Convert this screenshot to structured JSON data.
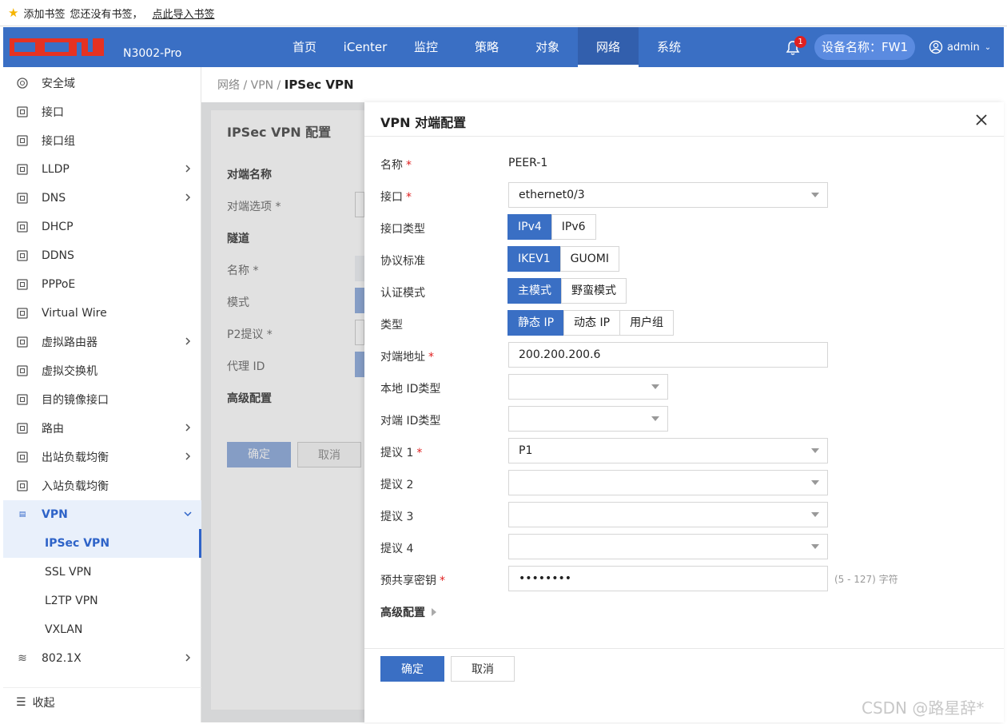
{
  "bookmark_bar": {
    "add_label": "添加书签",
    "no_bookmark_text": "您还没有书签，",
    "import_link": "点此导入书签"
  },
  "header": {
    "logo_text": "DCN",
    "model": "N3002-Pro",
    "menu": [
      "首页",
      "iCenter",
      "监控",
      "策略",
      "对象",
      "网络",
      "系统"
    ],
    "active_menu": "网络",
    "notification_count": "1",
    "device_name": "设备名称：FW1",
    "user": "admin"
  },
  "sidebar": {
    "items": [
      {
        "label": "安全域",
        "icon": "target-icon",
        "has_arrow": false
      },
      {
        "label": "接口",
        "icon": "interface-icon",
        "has_arrow": false
      },
      {
        "label": "接口组",
        "icon": "interface-group-icon",
        "has_arrow": false
      },
      {
        "label": "LLDP",
        "icon": "lldp-icon",
        "has_arrow": true
      },
      {
        "label": "DNS",
        "icon": "dns-icon",
        "has_arrow": true
      },
      {
        "label": "DHCP",
        "icon": "dhcp-icon",
        "has_arrow": false
      },
      {
        "label": "DDNS",
        "icon": "ddns-icon",
        "has_arrow": false
      },
      {
        "label": "PPPoE",
        "icon": "pppoe-icon",
        "has_arrow": false
      },
      {
        "label": "Virtual Wire",
        "icon": "virtual-wire-icon",
        "has_arrow": false
      },
      {
        "label": "虚拟路由器",
        "icon": "virtual-router-icon",
        "has_arrow": true
      },
      {
        "label": "虚拟交换机",
        "icon": "virtual-switch-icon",
        "has_arrow": false
      },
      {
        "label": "目的镜像接口",
        "icon": "mirror-icon",
        "has_arrow": false
      },
      {
        "label": "路由",
        "icon": "route-icon",
        "has_arrow": true
      },
      {
        "label": "出站负载均衡",
        "icon": "outbound-icon",
        "has_arrow": true
      },
      {
        "label": "入站负载均衡",
        "icon": "inbound-icon",
        "has_arrow": false
      }
    ],
    "vpn": {
      "label": "VPN",
      "icon": "vpn-icon"
    },
    "vpn_sub": [
      "IPSec VPN",
      "SSL VPN",
      "L2TP VPN",
      "VXLAN"
    ],
    "active_sub": "IPSec VPN",
    "dot1x": {
      "label": "802.1X",
      "icon": "wifi-8021x-icon"
    },
    "collapse_label": "收起"
  },
  "breadcrumb": {
    "path": "网络 / VPN / ",
    "current": "IPSec VPN"
  },
  "background_form": {
    "title": "IPSec VPN 配置",
    "rows": [
      "对端名称",
      "对端选项 *",
      "隧道",
      "名称 *",
      "模式",
      "P2提议 *",
      "代理 ID",
      "高级配置"
    ],
    "ok": "确定",
    "cancel": "取消"
  },
  "panel": {
    "title": "VPN 对端配置",
    "fields": {
      "name": {
        "label": "名称",
        "value": "PEER-1"
      },
      "interface": {
        "label": "接口",
        "value": "ethernet0/3"
      },
      "interface_type": {
        "label": "接口类型",
        "options": [
          "IPv4",
          "IPv6"
        ],
        "selected": "IPv4"
      },
      "protocol": {
        "label": "协议标准",
        "options": [
          "IKEV1",
          "GUOMI"
        ],
        "selected": "IKEV1"
      },
      "auth_mode": {
        "label": "认证模式",
        "options": [
          "主模式",
          "野蛮模式"
        ],
        "selected": "主模式"
      },
      "type": {
        "label": "类型",
        "options": [
          "静态 IP",
          "动态 IP",
          "用户组"
        ],
        "selected": "静态 IP"
      },
      "peer_address": {
        "label": "对端地址",
        "value": "200.200.200.6"
      },
      "local_id_type": {
        "label": "本地 ID类型",
        "value": ""
      },
      "peer_id_type": {
        "label": "对端 ID类型",
        "value": ""
      },
      "proposal1": {
        "label": "提议 1",
        "value": "P1"
      },
      "proposal2": {
        "label": "提议 2",
        "value": ""
      },
      "proposal3": {
        "label": "提议 3",
        "value": ""
      },
      "proposal4": {
        "label": "提议 4",
        "value": ""
      },
      "psk": {
        "label": "预共享密钥",
        "value": "••••••••",
        "hint": "(5 - 127) 字符"
      }
    },
    "advanced": "高级配置",
    "ok": "确定",
    "cancel": "取消"
  },
  "watermark": "CSDN @路星辞*",
  "colors": {
    "primary": "#3a6fc4",
    "required": "#e02020",
    "header": "#3a6fc4"
  }
}
